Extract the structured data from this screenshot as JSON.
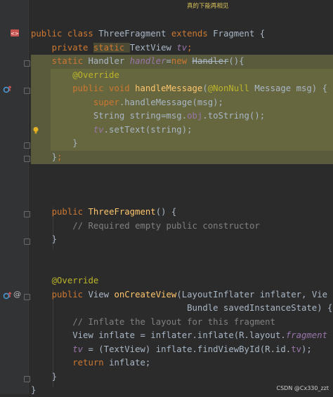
{
  "top_banner": "真的下能再相见",
  "watermark": "CSDN @Cx330_zzt",
  "icons": {
    "class_icon": "class-icon",
    "override_icon": "override-arrow-icon",
    "bulb_icon": "lightbulb-icon",
    "at_icon": "at-icon"
  },
  "code": {
    "l1": [
      "public class ",
      "ThreeFragment ",
      "extends ",
      "Fragment {"
    ],
    "l2": [
      "private ",
      "static ",
      "TextView ",
      "tv",
      ";"
    ],
    "l3": [
      "static ",
      "Handler ",
      "handler",
      "=",
      "new ",
      "Handler",
      "(){"
    ],
    "l4": [
      "@Override"
    ],
    "l5": [
      "public void ",
      "handleMessage",
      "(",
      "@NonNull ",
      "Message msg) {"
    ],
    "l6": [
      "super",
      ".handleMessage(msg);"
    ],
    "l7": [
      "String string=msg.",
      "obj",
      ".toString();"
    ],
    "l8": [
      "tv",
      ".setText(string);"
    ],
    "l9": [
      "}"
    ],
    "l10": [
      "}",
      ";"
    ],
    "l11": [
      "public ",
      "ThreeFragment",
      "() {"
    ],
    "l12": [
      "// Required empty public constructor"
    ],
    "l13": [
      "}"
    ],
    "l14": [
      "@Override"
    ],
    "l15": [
      "public ",
      "View ",
      "onCreateView",
      "(LayoutInflater inflater, Vie"
    ],
    "l16": [
      "Bundle savedInstanceState) {"
    ],
    "l17": [
      "// Inflate the layout for this fragment"
    ],
    "l18": [
      "View inflate = inflater.inflate(R.layout.",
      "fragment"
    ],
    "l19": [
      "tv",
      " = (TextView) inflate.findViewById(R.id.",
      "tv",
      ");"
    ],
    "l20": [
      "return ",
      "inflate;"
    ],
    "l21": [
      "}"
    ],
    "l22": [
      "}"
    ]
  }
}
